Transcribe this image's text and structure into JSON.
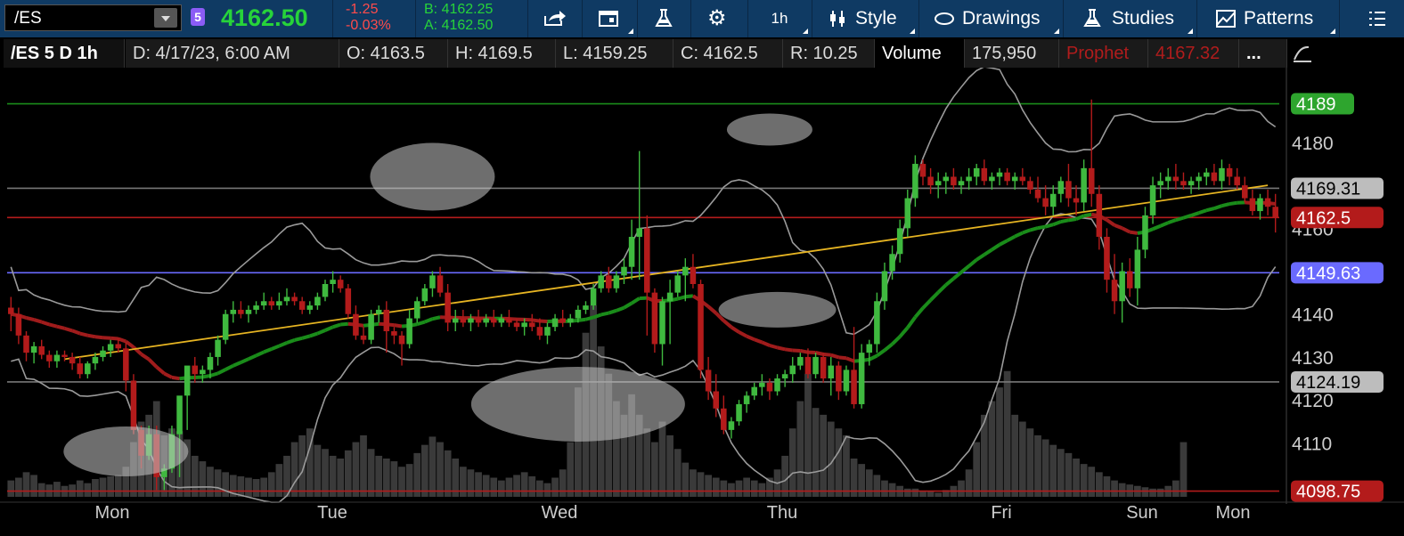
{
  "toolbar": {
    "symbol": "/ES",
    "badge": "5",
    "last": "4162.50",
    "change": "-1.25",
    "change_pct": "-0.03%",
    "bid": "B: 4162.25",
    "ask": "A: 4162.50",
    "interval": "1h",
    "style_label": "Style",
    "drawings_label": "Drawings",
    "studies_label": "Studies",
    "patterns_label": "Patterns",
    "icons": [
      "share-icon",
      "calendar-icon",
      "flask-icon",
      "gear-icon",
      "style-icon",
      "ellipse-icon",
      "beaker-icon",
      "patterns-icon",
      "menu-icon"
    ]
  },
  "header": {
    "chart_id": "/ES 5 D 1h",
    "date": "D: 4/17/23, 6:00 AM",
    "open": "O: 4163.5",
    "high": "H: 4169.5",
    "low": "L: 4159.25",
    "close": "C: 4162.5",
    "range": "R: 10.25",
    "volume_label": "Volume",
    "volume_value": "175,950",
    "prophet_label": "Prophet",
    "prophet_value": "4167.32",
    "more": "..."
  },
  "colors": {
    "up": "#3fb93f",
    "down": "#b31b1b",
    "upper_line": "#1a8c1a",
    "lower_line": "#a01c1c",
    "blue_line": "#6a6aff",
    "trend": "#e6b422",
    "bb": "#9a9a9a"
  },
  "chart_data": {
    "type": "candlestick",
    "y_ticks": [
      4110,
      4120,
      4130,
      4140,
      4160,
      4180
    ],
    "x_labels": [
      "Mon",
      "Tue",
      "Wed",
      "Thu",
      "Fri",
      "Sun",
      "Mon"
    ],
    "ylim": [
      4097,
      4197
    ],
    "levels": [
      {
        "label": "4189",
        "value": 4189,
        "color": "#1a8c1a",
        "box": "#2ea52e",
        "text": "#fff"
      },
      {
        "label": "4169.31",
        "value": 4169.31,
        "color": "#777",
        "box": "#bdbdbd",
        "text": "#000"
      },
      {
        "label": "4162.5",
        "value": 4162.5,
        "color": "#b31b1b",
        "box": "#b31b1b",
        "text": "#fff"
      },
      {
        "label": "4149.63",
        "value": 4149.63,
        "color": "#6a6aff",
        "box": "#6a6aff",
        "text": "#fff"
      },
      {
        "label": "4124.19",
        "value": 4124.19,
        "color": "#777",
        "box": "#bdbdbd",
        "text": "#000"
      },
      {
        "label": "4098.75",
        "value": 4098.75,
        "color": "#b31b1b",
        "box": "#b31b1b",
        "text": "#fff"
      }
    ],
    "candles": [
      [
        4141.5,
        4144,
        4136,
        4140
      ],
      [
        4140,
        4141.5,
        4133,
        4135
      ],
      [
        4135,
        4136,
        4129,
        4131
      ],
      [
        4131,
        4133.5,
        4128.5,
        4132.5
      ],
      [
        4132.5,
        4134,
        4129.5,
        4130.5
      ],
      [
        4130.5,
        4131.5,
        4127.5,
        4129
      ],
      [
        4129,
        4131.5,
        4127.5,
        4130.5
      ],
      [
        4130.5,
        4131.5,
        4129,
        4130
      ],
      [
        4130,
        4131,
        4127,
        4128.5
      ],
      [
        4128.5,
        4130,
        4125,
        4126
      ],
      [
        4126,
        4129,
        4125,
        4128.5
      ],
      [
        4128.5,
        4131,
        4127,
        4130
      ],
      [
        4130,
        4132.5,
        4129,
        4131.5
      ],
      [
        4131.5,
        4134,
        4130,
        4133
      ],
      [
        4133,
        4134.5,
        4131,
        4132
      ],
      [
        4132,
        4133.5,
        4122,
        4124.5
      ],
      [
        4124.5,
        4126,
        4112,
        4113
      ],
      [
        4113,
        4114,
        4104,
        4107
      ],
      [
        4107,
        4114,
        4106,
        4112
      ],
      [
        4112,
        4114,
        4099,
        4102
      ],
      [
        4102,
        4105,
        4099,
        4104
      ],
      [
        4104,
        4114,
        4103,
        4112
      ],
      [
        4112,
        4120,
        4102,
        4121
      ],
      [
        4121,
        4127,
        4113,
        4128
      ],
      [
        4128,
        4130,
        4124,
        4126
      ],
      [
        4126,
        4128,
        4124,
        4127
      ],
      [
        4127,
        4131,
        4125,
        4130
      ],
      [
        4130,
        4135,
        4128,
        4134
      ],
      [
        4134,
        4141,
        4133,
        4140
      ],
      [
        4140,
        4143,
        4138,
        4141
      ],
      [
        4141,
        4143,
        4139,
        4140
      ],
      [
        4140,
        4142,
        4138,
        4141
      ],
      [
        4141,
        4143,
        4140,
        4142
      ],
      [
        4142,
        4145,
        4141,
        4143
      ],
      [
        4143,
        4144,
        4141,
        4142
      ],
      [
        4142,
        4145,
        4141,
        4143
      ],
      [
        4143,
        4146,
        4142,
        4144
      ],
      [
        4144,
        4145,
        4142,
        4143
      ],
      [
        4143,
        4144,
        4140,
        4141
      ],
      [
        4141,
        4143,
        4140,
        4142
      ],
      [
        4142,
        4145,
        4141,
        4144
      ],
      [
        4144,
        4148,
        4143,
        4147
      ],
      [
        4147,
        4150,
        4145,
        4148
      ],
      [
        4148,
        4149,
        4145,
        4146
      ],
      [
        4146,
        4147,
        4139,
        4140
      ],
      [
        4140,
        4142,
        4134,
        4135
      ],
      [
        4135,
        4137,
        4133,
        4134
      ],
      [
        4134,
        4141,
        4133,
        4140
      ],
      [
        4140,
        4142,
        4138,
        4141
      ],
      [
        4141,
        4143,
        4131,
        4136
      ],
      [
        4136,
        4137,
        4133,
        4135
      ],
      [
        4135,
        4136,
        4128,
        4133
      ],
      [
        4133,
        4141,
        4132,
        4139
      ],
      [
        4139,
        4144,
        4138,
        4143
      ],
      [
        4143,
        4147,
        4142,
        4146
      ],
      [
        4146,
        4150,
        4144,
        4149
      ],
      [
        4149,
        4151,
        4144,
        4145
      ],
      [
        4145,
        4147,
        4136,
        4138
      ],
      [
        4138,
        4141,
        4136,
        4139
      ],
      [
        4139,
        4141,
        4137,
        4138
      ],
      [
        4138,
        4140,
        4136,
        4139
      ],
      [
        4139,
        4141,
        4137,
        4138
      ],
      [
        4138,
        4140,
        4137,
        4139
      ],
      [
        4139,
        4141,
        4137,
        4138
      ],
      [
        4138,
        4140,
        4137,
        4139
      ],
      [
        4139,
        4141,
        4137,
        4138
      ],
      [
        4138,
        4139,
        4136,
        4137
      ],
      [
        4137,
        4139,
        4135,
        4138
      ],
      [
        4138,
        4140,
        4136,
        4137
      ],
      [
        4137,
        4139,
        4134,
        4135
      ],
      [
        4135,
        4138,
        4133,
        4137
      ],
      [
        4137,
        4140,
        4136,
        4139
      ],
      [
        4139,
        4141,
        4137,
        4138
      ],
      [
        4138,
        4140,
        4137,
        4139
      ],
      [
        4139,
        4142,
        4138,
        4141
      ],
      [
        4141,
        4143,
        4140,
        4142
      ],
      [
        4142,
        4147,
        4141,
        4146
      ],
      [
        4146,
        4150,
        4145,
        4149
      ],
      [
        4149,
        4151,
        4145,
        4146
      ],
      [
        4146,
        4150,
        4145,
        4149
      ],
      [
        4149,
        4153,
        4147,
        4151
      ],
      [
        4151,
        4162,
        4148,
        4158
      ],
      [
        4158,
        4178,
        4148,
        4160
      ],
      [
        4160,
        4163,
        4135,
        4145
      ],
      [
        4145,
        4146,
        4131,
        4133
      ],
      [
        4133,
        4144,
        4128,
        4143
      ],
      [
        4143,
        4148,
        4133,
        4145
      ],
      [
        4145,
        4150,
        4144,
        4149
      ],
      [
        4149,
        4153,
        4143,
        4151
      ],
      [
        4151,
        4154,
        4146,
        4147
      ],
      [
        4147,
        4148,
        4125,
        4127
      ],
      [
        4127,
        4130,
        4120,
        4122
      ],
      [
        4122,
        4126,
        4116,
        4118
      ],
      [
        4118,
        4121,
        4112,
        4113
      ],
      [
        4113,
        4116,
        4111,
        4115
      ],
      [
        4115,
        4120,
        4114,
        4119
      ],
      [
        4119,
        4122,
        4117,
        4121
      ],
      [
        4121,
        4124,
        4120,
        4123
      ],
      [
        4123,
        4126,
        4121,
        4124
      ],
      [
        4124,
        4125,
        4120,
        4122
      ],
      [
        4122,
        4126,
        4121,
        4125
      ],
      [
        4125,
        4127,
        4123,
        4126
      ],
      [
        4126,
        4130,
        4124,
        4128
      ],
      [
        4128,
        4131,
        4127,
        4130
      ],
      [
        4130,
        4132,
        4125,
        4126
      ],
      [
        4126,
        4131,
        4125,
        4130
      ],
      [
        4130,
        4131,
        4124,
        4125
      ],
      [
        4125,
        4130,
        4121,
        4128
      ],
      [
        4128,
        4129,
        4120,
        4122
      ],
      [
        4122,
        4128,
        4121,
        4127
      ],
      [
        4127,
        4137,
        4118,
        4119
      ],
      [
        4119,
        4133,
        4118,
        4131
      ],
      [
        4131,
        4134,
        4128,
        4133
      ],
      [
        4133,
        4145,
        4131,
        4143
      ],
      [
        4143,
        4152,
        4141,
        4150
      ],
      [
        4150,
        4156,
        4148,
        4154
      ],
      [
        4154,
        4162,
        4152,
        4160
      ],
      [
        4160,
        4169,
        4158,
        4167
      ],
      [
        4167,
        4177,
        4165,
        4175
      ],
      [
        4175,
        4176,
        4170,
        4172
      ],
      [
        4172,
        4174,
        4168,
        4170
      ],
      [
        4170,
        4173,
        4167,
        4171
      ],
      [
        4171,
        4173,
        4168,
        4172
      ],
      [
        4172,
        4174,
        4169,
        4170
      ],
      [
        4170,
        4172,
        4168,
        4171
      ],
      [
        4171,
        4174,
        4169,
        4172
      ],
      [
        4172,
        4175,
        4170,
        4174
      ],
      [
        4174,
        4176,
        4170,
        4171
      ],
      [
        4171,
        4173,
        4169,
        4172
      ],
      [
        4172,
        4174,
        4170,
        4173
      ],
      [
        4173,
        4174,
        4170,
        4171
      ],
      [
        4171,
        4173,
        4169,
        4172
      ],
      [
        4172,
        4174,
        4170,
        4171
      ],
      [
        4171,
        4172,
        4168,
        4169
      ],
      [
        4169,
        4172,
        4166,
        4167
      ],
      [
        4167,
        4170,
        4163,
        4165
      ],
      [
        4165,
        4170,
        4163,
        4168
      ],
      [
        4168,
        4172,
        4166,
        4171
      ],
      [
        4171,
        4175,
        4165,
        4167
      ],
      [
        4167,
        4170,
        4163,
        4166
      ],
      [
        4166,
        4176,
        4164,
        4174
      ],
      [
        4174,
        4190,
        4165,
        4168
      ],
      [
        4168,
        4170,
        4155,
        4158
      ],
      [
        4158,
        4160,
        4145,
        4148
      ],
      [
        4148,
        4154,
        4140,
        4143
      ],
      [
        4143,
        4152,
        4138,
        4150
      ],
      [
        4150,
        4153,
        4144,
        4146
      ],
      [
        4146,
        4158,
        4142,
        4155
      ],
      [
        4155,
        4165,
        4153,
        4163
      ],
      [
        4163,
        4172,
        4161,
        4170
      ],
      [
        4170,
        4173,
        4167,
        4171
      ],
      [
        4171,
        4174,
        4169,
        4172
      ],
      [
        4172,
        4175,
        4169,
        4171
      ],
      [
        4171,
        4173,
        4169,
        4170
      ],
      [
        4170,
        4172,
        4168,
        4171
      ],
      [
        4171,
        4173,
        4169,
        4172
      ],
      [
        4172,
        4174,
        4170,
        4173
      ],
      [
        4173,
        4175,
        4170,
        4171
      ],
      [
        4171,
        4176,
        4169,
        4174
      ],
      [
        4174,
        4175,
        4170,
        4172
      ],
      [
        4172,
        4174,
        4169,
        4170
      ],
      [
        4170,
        4172,
        4166,
        4167
      ],
      [
        4167,
        4169,
        4163,
        4164
      ],
      [
        4164,
        4168,
        4162,
        4167
      ],
      [
        4167,
        4169,
        4163,
        4165
      ],
      [
        4165,
        4168,
        4159,
        4162.5
      ]
    ],
    "volumes": [
      12,
      14,
      18,
      16,
      10,
      9,
      11,
      8,
      9,
      12,
      10,
      13,
      14,
      15,
      16,
      22,
      40,
      55,
      60,
      70,
      45,
      50,
      48,
      42,
      30,
      26,
      22,
      20,
      18,
      16,
      15,
      14,
      13,
      14,
      18,
      24,
      30,
      40,
      45,
      50,
      38,
      35,
      30,
      28,
      34,
      40,
      45,
      35,
      30,
      28,
      26,
      22,
      24,
      32,
      38,
      44,
      40,
      34,
      28,
      22,
      20,
      18,
      16,
      14,
      12,
      14,
      16,
      18,
      15,
      12,
      10,
      14,
      20,
      40,
      80,
      120,
      140,
      110,
      90,
      70,
      60,
      75,
      60,
      50,
      40,
      55,
      45,
      35,
      25,
      20,
      18,
      16,
      14,
      12,
      10,
      12,
      14,
      12,
      10,
      14,
      20,
      30,
      50,
      70,
      90,
      65,
      60,
      55,
      50,
      45,
      28,
      24,
      20,
      16,
      12,
      10,
      8,
      6,
      6,
      4,
      4,
      3,
      5,
      8,
      12,
      20,
      40,
      60,
      70,
      80,
      92,
      60,
      55,
      50,
      45,
      42,
      38,
      35,
      32,
      28,
      24,
      22,
      18,
      15,
      12,
      10,
      9,
      8,
      7,
      6,
      6,
      8,
      12,
      40
    ],
    "ellipses": [
      {
        "cx": 4108,
        "i": 15
      },
      {
        "cx": 4172,
        "i": 55
      },
      {
        "cx": 4119,
        "i": 74
      },
      {
        "cx": 4183,
        "i": 99
      },
      {
        "cx": 4141,
        "i": 100
      }
    ]
  }
}
